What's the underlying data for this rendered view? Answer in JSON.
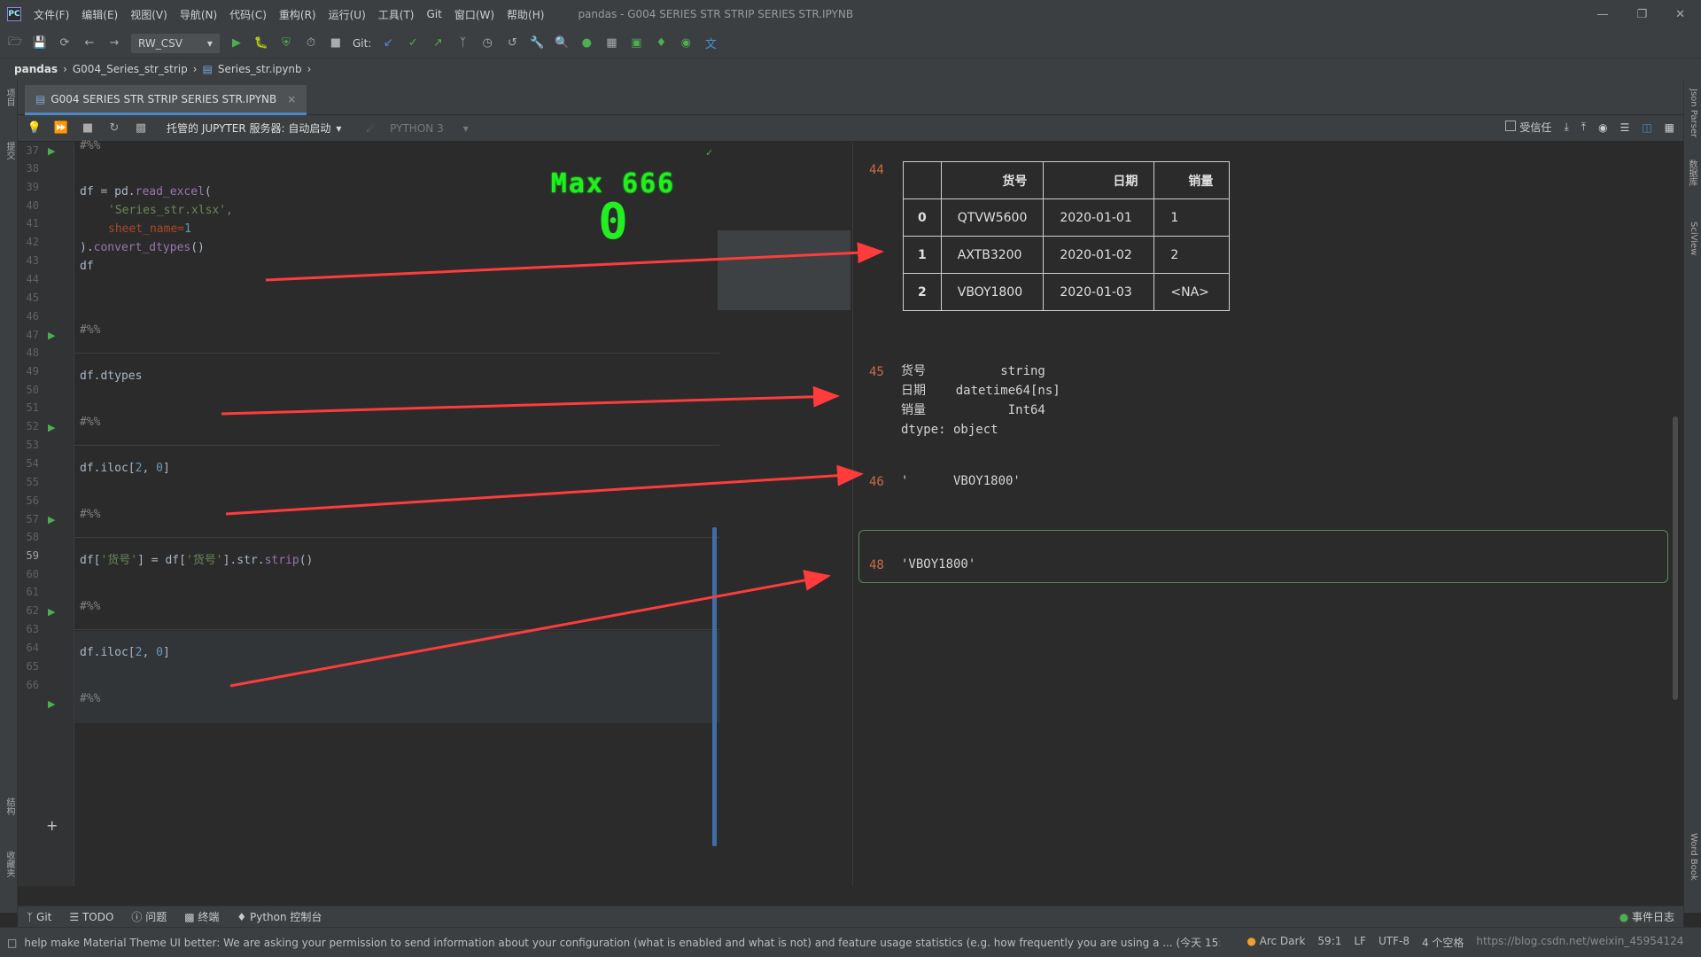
{
  "app": {
    "logo": "PC",
    "window_title": "pandas - G004 SERIES STR STRIP SERIES STR.IPYNB"
  },
  "menu": [
    "文件(F)",
    "编辑(E)",
    "视图(V)",
    "导航(N)",
    "代码(C)",
    "重构(R)",
    "运行(U)",
    "工具(T)",
    "Git",
    "窗口(W)",
    "帮助(H)"
  ],
  "toolbar": {
    "run_config": "RW_CSV",
    "git_label": "Git:"
  },
  "breadcrumb": [
    "pandas",
    "G004_Series_str_strip",
    "Series_str.ipynb"
  ],
  "tab": {
    "label": "G004 SERIES STR STRIP SERIES STR.IPYNB"
  },
  "notebook_toolbar": {
    "server": "托管的 JUPYTER 服务器: 自动启动",
    "kernel": "PYTHON 3",
    "trusted": "受信任"
  },
  "left_tool": [
    "项目",
    "提交",
    "结构",
    "收藏夹"
  ],
  "right_tool": [
    "Json Parser",
    "数据库",
    "SciView",
    "Word Book"
  ],
  "line_numbers": [
    "37",
    "38",
    "39",
    "40",
    "41",
    "42",
    "43",
    "44",
    "45",
    "46",
    "47",
    "48",
    "49",
    "50",
    "51",
    "52",
    "53",
    "54",
    "55",
    "56",
    "57",
    "58",
    "59",
    "60",
    "61",
    "62",
    "63",
    "64",
    "65",
    "66"
  ],
  "code": {
    "c38": "#%%",
    "c40a": "df = pd.",
    "c40b": "read_excel",
    "c40c": "(",
    "c41": "'Series_str.xlsx',",
    "c42a": "sheet_name=",
    "c42b": "1",
    "c43a": ").",
    "c43b": "convert_dtypes",
    "c43c": "()",
    "c44": "df",
    "c46": "#%%",
    "c48": "df.dtypes",
    "c50": "#%%",
    "c52a": "df.iloc[",
    "c52b": "2",
    "c52c": ", ",
    "c52d": "0",
    "c52e": "]",
    "c54": "#%%",
    "c56a": "df[",
    "c56b": "'货号'",
    "c56c": "] = df[",
    "c56d": "'货号'",
    "c56e": "].str.",
    "c56f": "strip",
    "c56g": "()",
    "c58": "#%%",
    "c60a": "df.iloc[",
    "c60b": "2",
    "c60c": ", ",
    "c60d": "0",
    "c60e": "]",
    "c62": "#%%"
  },
  "overlay": {
    "line1": "Max 666",
    "line2": "0"
  },
  "outputs": {
    "o44_num": "44",
    "table": {
      "columns": [
        "",
        "货号",
        "日期",
        "销量"
      ],
      "rows": [
        [
          "0",
          "QTVW5600",
          "2020-01-01",
          "1"
        ],
        [
          "1",
          "AXTB3200",
          "2020-01-02",
          "2"
        ],
        [
          "2",
          "VBOY1800",
          "2020-01-03",
          "<NA>"
        ]
      ]
    },
    "o45_num": "45",
    "o45_text": "货号          string\n日期    datetime64[ns]\n销量           Int64\ndtype: object",
    "o46_num": "46",
    "o46_text": "'      VBOY1800'",
    "o48_num": "48",
    "o48_text": "'VBOY1800'"
  },
  "bottom_tabs": [
    "Git",
    "TODO",
    "问题",
    "终端",
    "Python 控制台"
  ],
  "bottom_right": "事件日志",
  "status": {
    "message": "help make Material Theme UI better: We are asking your permission to send information about your configuration (what is enabled and what is not) and feature usage statistics (e.g. how frequently you are using a ... (今天 15:17)",
    "theme": "Arc Dark",
    "position": "59:1",
    "line_sep": "LF",
    "encoding": "UTF-8",
    "indent": "4 个空格",
    "watermark": "https://blog.csdn.net/weixin_45954124"
  },
  "colors": {
    "arrow": "#ff3b3b",
    "accent": "#4a88c7",
    "overlay": "#22ee22"
  }
}
